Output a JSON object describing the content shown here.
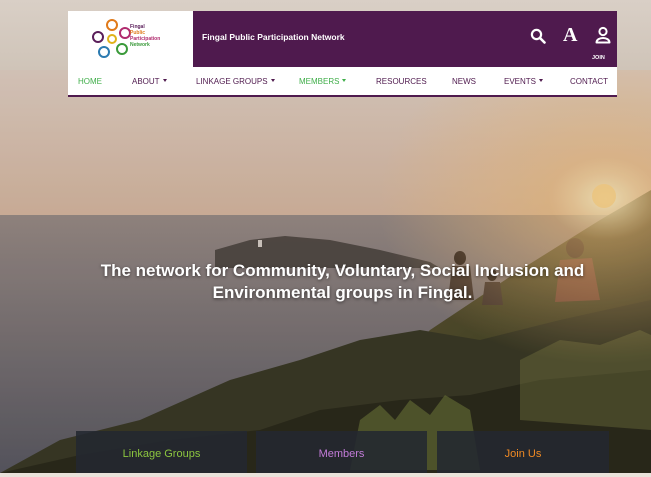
{
  "header": {
    "logo": {
      "lines": [
        "Fingal",
        "Public",
        "Participation",
        "Network"
      ]
    },
    "title": "Fingal Public Participation Network",
    "join_label": "JOIN",
    "font_icon": "A",
    "icons": [
      "search-icon",
      "font-size-icon",
      "user-icon"
    ],
    "colors": {
      "brand": "#4f1a4e",
      "active": "#3fae49"
    }
  },
  "nav": {
    "items": [
      {
        "label": "HOME"
      },
      {
        "label": "ABOUT"
      },
      {
        "label": "LINKAGE GROUPS"
      },
      {
        "label": "MEMBERS"
      },
      {
        "label": "RESOURCES"
      },
      {
        "label": "NEWS"
      },
      {
        "label": "EVENTS"
      },
      {
        "label": "CONTACT"
      }
    ]
  },
  "hero": {
    "tagline": "The network for Community, Voluntary, Social Inclusion and Environmental groups in Fingal."
  },
  "cta": {
    "boxes": [
      {
        "label": "Linkage Groups",
        "color": "#8cc63f"
      },
      {
        "label": "Members",
        "color": "#c27bd8"
      },
      {
        "label": "Join Us",
        "color": "#f08a24"
      }
    ]
  }
}
